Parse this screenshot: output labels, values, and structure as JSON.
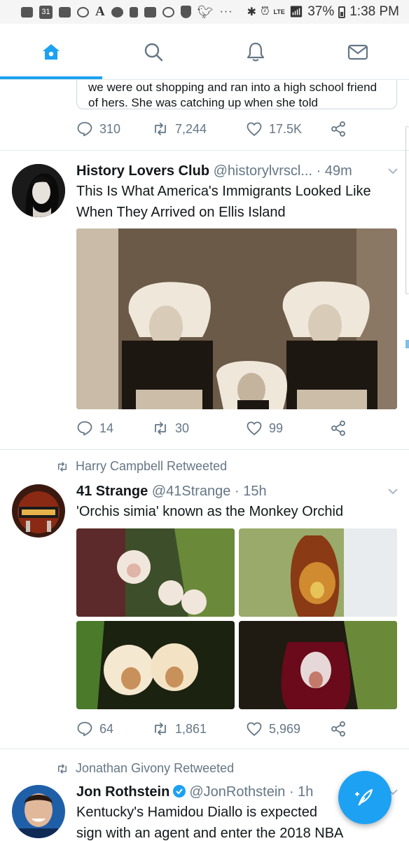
{
  "status_bar": {
    "battery": "37%",
    "time": "1:38 PM",
    "signal_label": "LTE",
    "calendar_day": "31",
    "more": "···"
  },
  "tabs": [
    {
      "name": "home",
      "icon": "home-icon",
      "active": true
    },
    {
      "name": "search",
      "icon": "search-icon",
      "active": false
    },
    {
      "name": "notifications",
      "icon": "bell-icon",
      "active": false
    },
    {
      "name": "messages",
      "icon": "mail-icon",
      "active": false
    }
  ],
  "colors": {
    "accent": "#1da1f2",
    "text": "#14171a",
    "muted": "#657786",
    "divider": "#e1e8ed"
  },
  "tweets": [
    {
      "quote_text": "we were out shopping and ran into a high school friend of hers. She was catching up when she told",
      "replies": "310",
      "retweets": "7,244",
      "likes": "17.5K"
    },
    {
      "name": "History Lovers Club",
      "handle": "@historylvrscl...",
      "time": "· 49m",
      "text": "This Is What America's Immigrants Looked Like When They Arrived on Ellis Island",
      "media": "photo",
      "replies": "14",
      "retweets": "30",
      "likes": "99"
    },
    {
      "retweeted_by": "Harry Campbell Retweeted",
      "name": "41 Strange",
      "handle": "@41Strange",
      "time": "· 15h",
      "text": "'Orchis simia' known as the Monkey Orchid",
      "media": "4 photos",
      "replies": "64",
      "retweets": "1,861",
      "likes": "5,969"
    },
    {
      "retweeted_by": "Jonathan Givony Retweeted",
      "name": "Jon Rothstein",
      "handle": "@JonRothstein",
      "time": "· 1h",
      "verified": true,
      "text_line1": "Kentucky's Hamidou Diallo is expected",
      "text_line2": "sign with an agent and enter the 2018 NBA"
    }
  ]
}
